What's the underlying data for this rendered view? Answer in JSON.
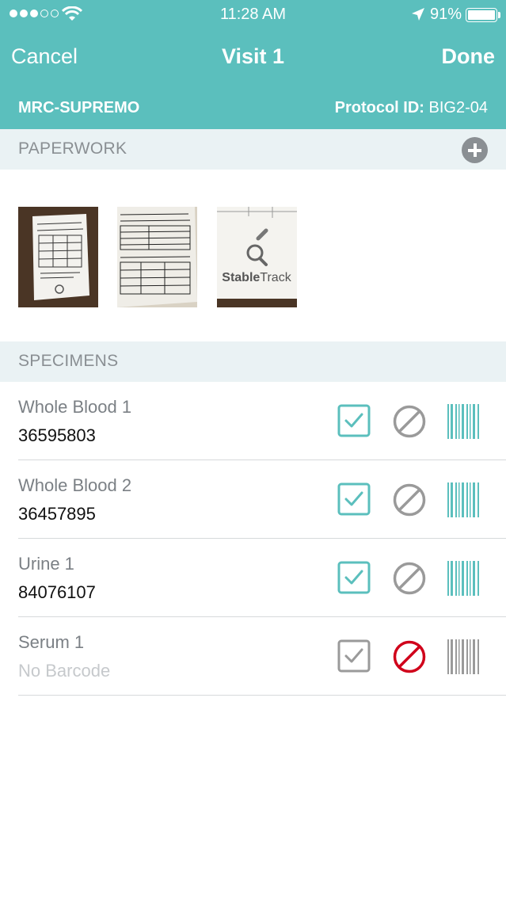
{
  "status_bar": {
    "time": "11:28 AM",
    "battery": "91%"
  },
  "nav": {
    "cancel_label": "Cancel",
    "title": "Visit 1",
    "done_label": "Done"
  },
  "subheader": {
    "study": "MRC-SUPREMO",
    "protocol_label": "Protocol ID:",
    "protocol_value": "BIG2-04"
  },
  "paperwork": {
    "header": "PAPERWORK",
    "thumbnails": [
      {
        "name": "paperwork-photo-1"
      },
      {
        "name": "paperwork-photo-2"
      },
      {
        "name": "paperwork-photo-3",
        "logo_text": "StableTrack"
      }
    ]
  },
  "specimens": {
    "header": "SPECIMENS",
    "items": [
      {
        "name": "Whole Blood 1",
        "barcode": "36595803",
        "collected": true,
        "not_collected": false
      },
      {
        "name": "Whole Blood 2",
        "barcode": "36457895",
        "collected": true,
        "not_collected": false
      },
      {
        "name": "Urine 1",
        "barcode": "84076107",
        "collected": true,
        "not_collected": false
      },
      {
        "name": "Serum 1",
        "barcode": "No Barcode",
        "collected": false,
        "not_collected": true
      }
    ]
  },
  "colors": {
    "accent": "#5bbfbd",
    "inactive": "#9a9a9a",
    "alert": "#d0021b"
  }
}
